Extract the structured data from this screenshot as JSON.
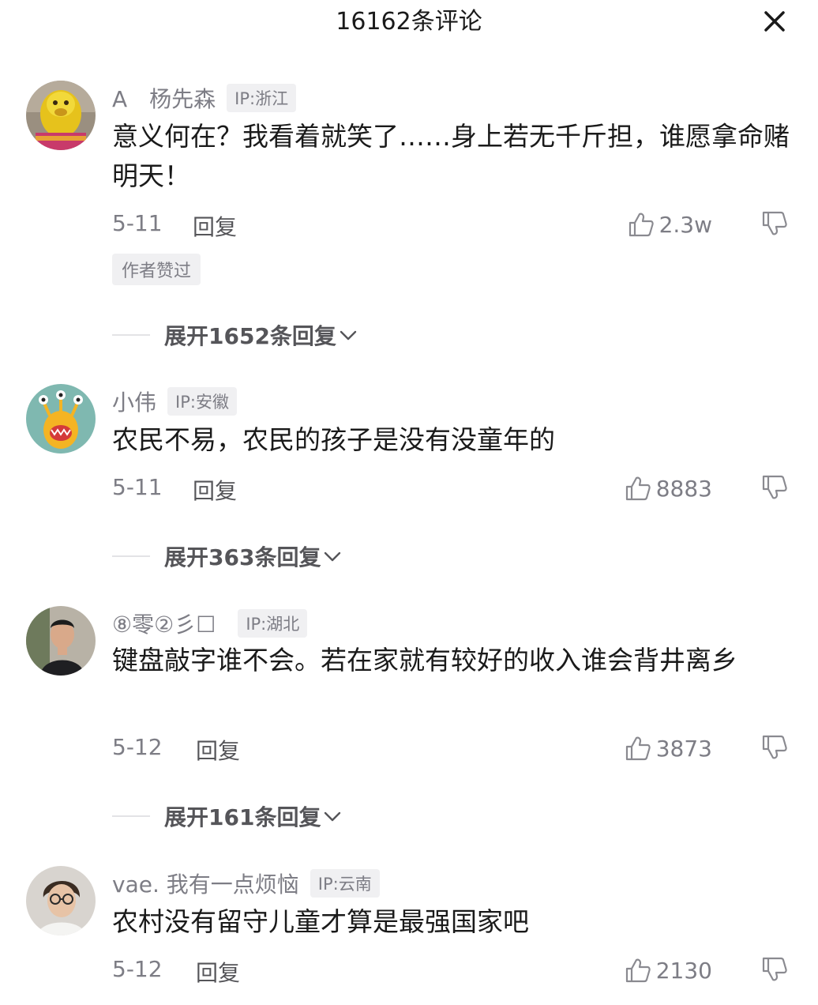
{
  "header": {
    "title": "16162条评论"
  },
  "comments": [
    {
      "username": "A　杨先森",
      "ip": "IP:浙江",
      "text": "意义何在？我看着就笑了……身上若无千斤担，谁愿拿命赌明天！",
      "date": "5-11",
      "reply_label": "回复",
      "likes": "2.3w",
      "badge": "作者赞过",
      "expand_label": "展开1652条回复",
      "avatar_icon": "lion-costume-avatar"
    },
    {
      "username": "小伟",
      "ip": "IP:安徽",
      "text": "农民不易，农民的孩子是没有没童年的",
      "date": "5-11",
      "reply_label": "回复",
      "likes": "8883",
      "expand_label": "展开363条回复",
      "avatar_icon": "cartoon-monster-avatar"
    },
    {
      "username": "⑧零②彡☐",
      "ip": "IP:湖北",
      "text": "键盘敲字谁不会。若在家就有较好的收入谁会背井离乡",
      "date": "5-12",
      "reply_label": "回复",
      "likes": "3873",
      "expand_label": "展开161条回复",
      "avatar_icon": "man-photo-avatar"
    },
    {
      "username": "vae. 我有一点烦恼",
      "ip": "IP:云南",
      "text": "农村没有留守儿童才算是最强国家吧",
      "date": "5-12",
      "reply_label": "回复",
      "likes": "2130",
      "avatar_icon": "glasses-man-avatar"
    }
  ],
  "colors": {
    "text_primary": "#1a1a1a",
    "text_secondary": "#7d7d85",
    "tag_background": "#f0f0f2"
  }
}
